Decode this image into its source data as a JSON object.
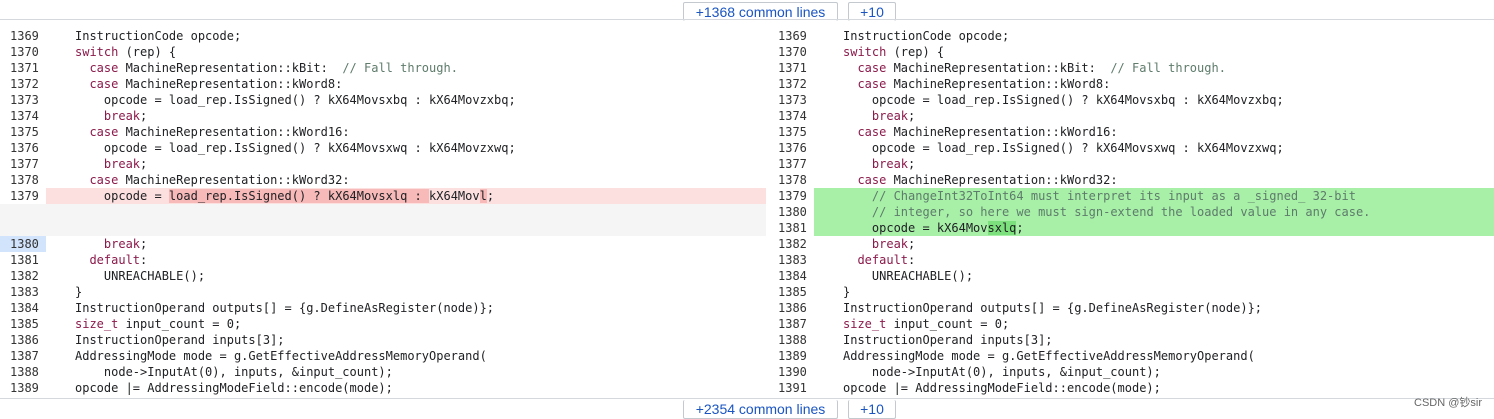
{
  "top_bar": {
    "common_label": "+1368 common lines",
    "more_label": "+10"
  },
  "bottom_bar": {
    "common_label": "+2354 common lines",
    "more_label": "+10"
  },
  "left": [
    {
      "n": "1369",
      "parts": [
        [
          "",
          "InstructionCode opcode;"
        ]
      ]
    },
    {
      "n": "1370",
      "parts": [
        [
          "kw",
          "switch"
        ],
        [
          "",
          " (rep) {"
        ]
      ]
    },
    {
      "n": "1371",
      "parts": [
        [
          "",
          "  "
        ],
        [
          "kw",
          "case"
        ],
        [
          "",
          " MachineRepresentation::kBit:  "
        ],
        [
          "cm",
          "// Fall through."
        ]
      ]
    },
    {
      "n": "1372",
      "parts": [
        [
          "",
          "  "
        ],
        [
          "kw",
          "case"
        ],
        [
          "",
          " MachineRepresentation::kWord8:"
        ]
      ]
    },
    {
      "n": "1373",
      "parts": [
        [
          "",
          "    opcode = load_rep.IsSigned() ? kX64Movsxbq : kX64Movzxbq;"
        ]
      ]
    },
    {
      "n": "1374",
      "parts": [
        [
          "",
          "    "
        ],
        [
          "kw",
          "break"
        ],
        [
          "",
          ";"
        ]
      ]
    },
    {
      "n": "1375",
      "parts": [
        [
          "",
          "  "
        ],
        [
          "kw",
          "case"
        ],
        [
          "",
          " MachineRepresentation::kWord16:"
        ]
      ]
    },
    {
      "n": "1376",
      "parts": [
        [
          "",
          "    opcode = load_rep.IsSigned() ? kX64Movsxwq : kX64Movzxwq;"
        ]
      ]
    },
    {
      "n": "1377",
      "parts": [
        [
          "",
          "    "
        ],
        [
          "kw",
          "break"
        ],
        [
          "",
          ";"
        ]
      ]
    },
    {
      "n": "1378",
      "parts": [
        [
          "",
          "  "
        ],
        [
          "kw",
          "case"
        ],
        [
          "",
          " MachineRepresentation::kWord32:"
        ]
      ]
    },
    {
      "n": "1379",
      "type": "del",
      "parts": [
        [
          "",
          "    opcode = "
        ],
        [
          "em",
          "load_rep.IsSigned() ? kX64Movsxlq : "
        ],
        [
          "",
          "kX64Mov"
        ],
        [
          "em",
          "l"
        ],
        [
          "",
          ";"
        ]
      ]
    },
    {
      "n": "",
      "type": "blank",
      "parts": []
    },
    {
      "n": "1380",
      "sel": true,
      "parts": [
        [
          "",
          "    "
        ],
        [
          "kw",
          "break"
        ],
        [
          "",
          ";"
        ]
      ]
    },
    {
      "n": "1381",
      "parts": [
        [
          "",
          "  "
        ],
        [
          "kw",
          "default"
        ],
        [
          "",
          ":"
        ]
      ]
    },
    {
      "n": "1382",
      "parts": [
        [
          "",
          "    UNREACHABLE();"
        ]
      ]
    },
    {
      "n": "1383",
      "parts": [
        [
          "",
          "}"
        ]
      ]
    },
    {
      "n": "1384",
      "parts": [
        [
          "",
          "InstructionOperand outputs[] = {g.DefineAsRegister(node)};"
        ]
      ]
    },
    {
      "n": "1385",
      "parts": [
        [
          "kw",
          "size_t"
        ],
        [
          "",
          " input_count = 0;"
        ]
      ]
    },
    {
      "n": "1386",
      "parts": [
        [
          "",
          "InstructionOperand inputs[3];"
        ]
      ]
    },
    {
      "n": "1387",
      "parts": [
        [
          "",
          "AddressingMode mode = g.GetEffectiveAddressMemoryOperand("
        ]
      ]
    },
    {
      "n": "1388",
      "parts": [
        [
          "",
          "    node->InputAt(0), inputs, &input_count);"
        ]
      ]
    },
    {
      "n": "1389",
      "parts": [
        [
          "",
          "opcode |= AddressingModeField::encode(mode);"
        ]
      ]
    }
  ],
  "right": [
    {
      "n": "1369",
      "parts": [
        [
          "",
          "InstructionCode opcode;"
        ]
      ]
    },
    {
      "n": "1370",
      "parts": [
        [
          "kw",
          "switch"
        ],
        [
          "",
          " (rep) {"
        ]
      ]
    },
    {
      "n": "1371",
      "parts": [
        [
          "",
          "  "
        ],
        [
          "kw",
          "case"
        ],
        [
          "",
          " MachineRepresentation::kBit:  "
        ],
        [
          "cm",
          "// Fall through."
        ]
      ]
    },
    {
      "n": "1372",
      "parts": [
        [
          "",
          "  "
        ],
        [
          "kw",
          "case"
        ],
        [
          "",
          " MachineRepresentation::kWord8:"
        ]
      ]
    },
    {
      "n": "1373",
      "parts": [
        [
          "",
          "    opcode = load_rep.IsSigned() ? kX64Movsxbq : kX64Movzxbq;"
        ]
      ]
    },
    {
      "n": "1374",
      "parts": [
        [
          "",
          "    "
        ],
        [
          "kw",
          "break"
        ],
        [
          "",
          ";"
        ]
      ]
    },
    {
      "n": "1375",
      "parts": [
        [
          "",
          "  "
        ],
        [
          "kw",
          "case"
        ],
        [
          "",
          " MachineRepresentation::kWord16:"
        ]
      ]
    },
    {
      "n": "1376",
      "parts": [
        [
          "",
          "    opcode = load_rep.IsSigned() ? kX64Movsxwq : kX64Movzxwq;"
        ]
      ]
    },
    {
      "n": "1377",
      "parts": [
        [
          "",
          "    "
        ],
        [
          "kw",
          "break"
        ],
        [
          "",
          ";"
        ]
      ]
    },
    {
      "n": "1378",
      "parts": [
        [
          "",
          "  "
        ],
        [
          "kw",
          "case"
        ],
        [
          "",
          " MachineRepresentation::kWord32:"
        ]
      ]
    },
    {
      "n": "1379",
      "type": "add",
      "parts": [
        [
          "",
          "    "
        ],
        [
          "cm",
          "// ChangeInt32ToInt64 must interpret its input as a _signed_ 32-bit"
        ]
      ]
    },
    {
      "n": "1380",
      "type": "add",
      "parts": [
        [
          "",
          "    "
        ],
        [
          "cm",
          "// integer, so here we must sign-extend the loaded value in any case."
        ]
      ]
    },
    {
      "n": "1381",
      "type": "add",
      "parts": [
        [
          "",
          "    opcode = kX64Mov"
        ],
        [
          "em",
          "sxlq"
        ],
        [
          "",
          ";"
        ]
      ]
    },
    {
      "n": "1382",
      "parts": [
        [
          "",
          "    "
        ],
        [
          "kw",
          "break"
        ],
        [
          "",
          ";"
        ]
      ]
    },
    {
      "n": "1383",
      "parts": [
        [
          "",
          "  "
        ],
        [
          "kw",
          "default"
        ],
        [
          "",
          ":"
        ]
      ]
    },
    {
      "n": "1384",
      "parts": [
        [
          "",
          "    UNREACHABLE();"
        ]
      ]
    },
    {
      "n": "1385",
      "parts": [
        [
          "",
          "}"
        ]
      ]
    },
    {
      "n": "1386",
      "parts": [
        [
          "",
          "InstructionOperand outputs[] = {g.DefineAsRegister(node)};"
        ]
      ]
    },
    {
      "n": "1387",
      "parts": [
        [
          "kw",
          "size_t"
        ],
        [
          "",
          " input_count = 0;"
        ]
      ]
    },
    {
      "n": "1388",
      "parts": [
        [
          "",
          "InstructionOperand inputs[3];"
        ]
      ]
    },
    {
      "n": "1389",
      "parts": [
        [
          "",
          "AddressingMode mode = g.GetEffectiveAddressMemoryOperand("
        ]
      ]
    },
    {
      "n": "1390",
      "parts": [
        [
          "",
          "    node->InputAt(0), inputs, &input_count);"
        ]
      ]
    },
    {
      "n": "1391",
      "parts": [
        [
          "",
          "opcode |= AddressingModeField::encode(mode);"
        ]
      ]
    }
  ],
  "watermark": "CSDN @钞sir"
}
